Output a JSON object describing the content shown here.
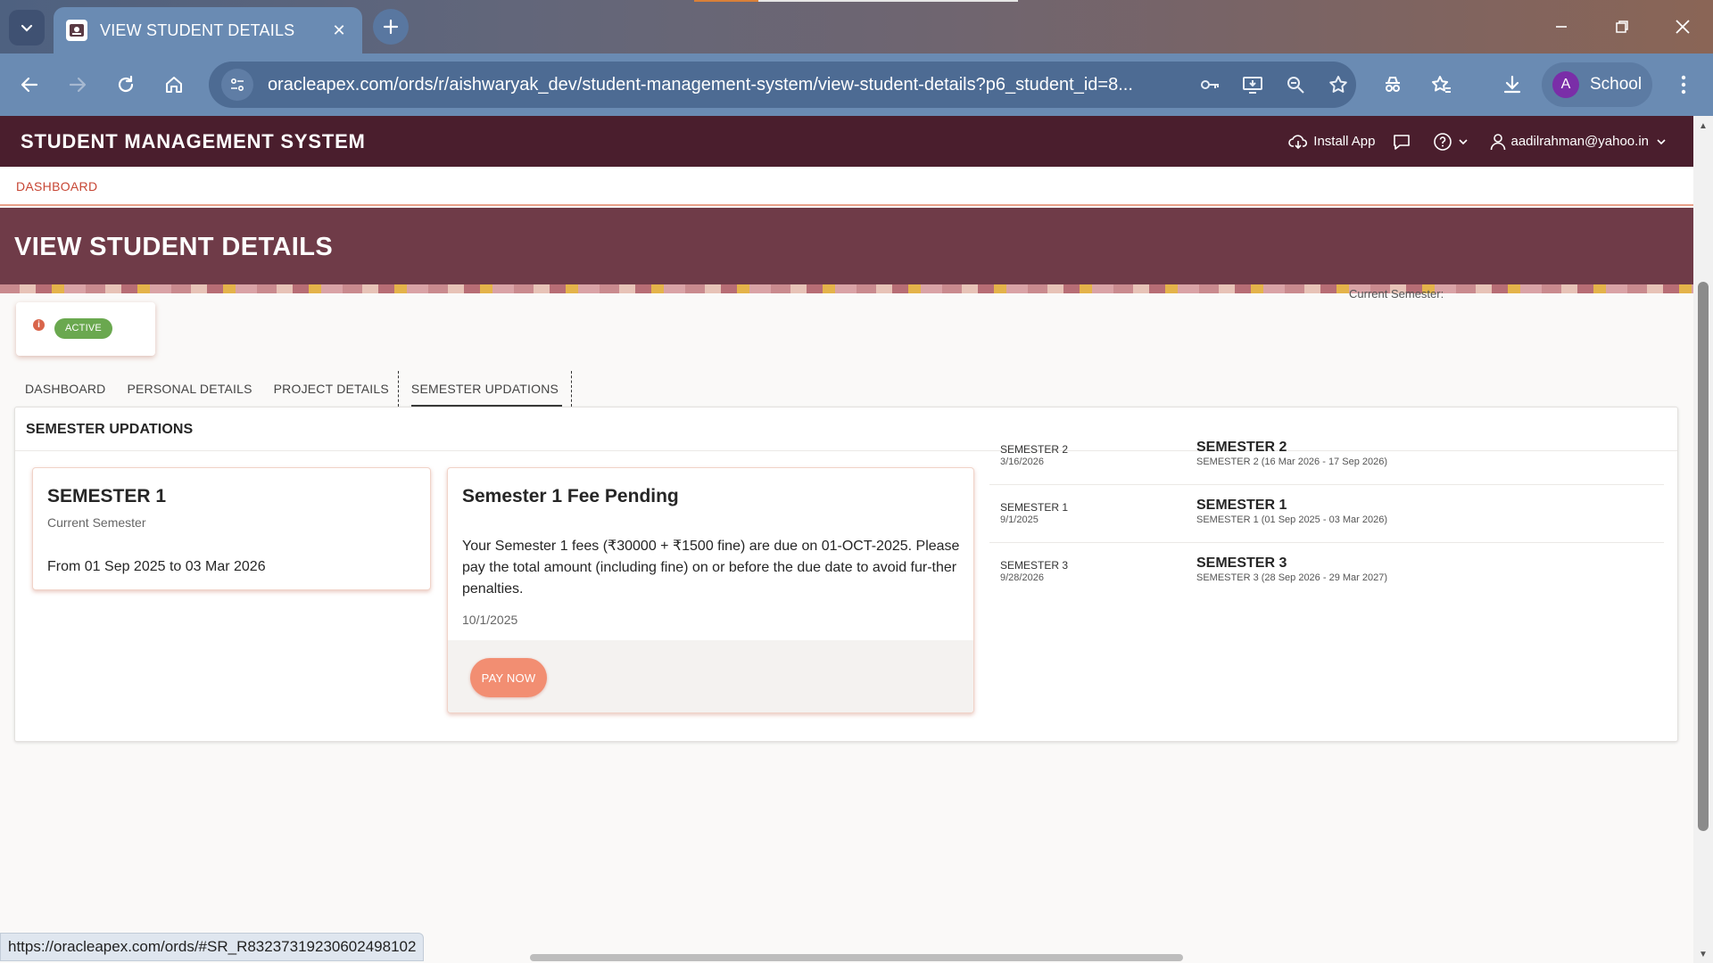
{
  "browser": {
    "tab_title": "VIEW STUDENT DETAILS",
    "url": "oracleapex.com/ords/r/aishwaryak_dev/student-management-system/view-student-details?p6_student_id=8...",
    "profile_initial": "A",
    "profile_name": "School",
    "status_url": "https://oracleapex.com/ords/#SR_R83237319230602498102"
  },
  "app": {
    "title": "STUDENT MANAGEMENT SYSTEM",
    "install_label": "Install App",
    "user_email": "aadilrahman@yahoo.in"
  },
  "breadcrumb": {
    "label": "DASHBOARD"
  },
  "hero": {
    "title": "VIEW STUDENT DETAILS",
    "overlap_text": "Current Semester: "
  },
  "status": {
    "badge": "ACTIVE",
    "info_icon": "i"
  },
  "tabs": [
    {
      "label": "DASHBOARD"
    },
    {
      "label": "PERSONAL DETAILS"
    },
    {
      "label": "PROJECT DETAILS"
    },
    {
      "label": "SEMESTER UPDATIONS"
    }
  ],
  "region": {
    "title": "SEMESTER UPDATIONS",
    "semester_card": {
      "title": "SEMESTER 1",
      "subtitle": "Current Semester",
      "range": "From 01 Sep 2025 to 03 Mar 2026"
    },
    "fee_card": {
      "title": "Semester 1 Fee Pending",
      "body": "Your Semester 1 fees (₹30000 + ₹1500 fine) are due on 01-OCT-2025. Please pay the total amount (including fine) on or before the due date to avoid fur-ther penalties.",
      "date": "10/1/2025",
      "button": "PAY NOW"
    },
    "timeline": [
      {
        "left_title": "SEMESTER 2",
        "left_date": "3/16/2026",
        "right_title": "SEMESTER 2",
        "right_sub": "SEMESTER 2 (16 Mar 2026 - 17 Sep 2026)"
      },
      {
        "left_title": "SEMESTER 1",
        "left_date": "9/1/2025",
        "right_title": "SEMESTER 1",
        "right_sub": "SEMESTER 1 (01 Sep 2025 - 03 Mar 2026)"
      },
      {
        "left_title": "SEMESTER 3",
        "left_date": "9/28/2026",
        "right_title": "SEMESTER 3",
        "right_sub": "SEMESTER 3 (28 Sep 2026 - 29 Mar 2027)"
      }
    ]
  },
  "colors": {
    "app_header": "#4a1e2d",
    "hero": "#6f3b48",
    "accent": "#c74634",
    "active_badge": "#6aa84f",
    "pay_button": "#f28e72"
  }
}
